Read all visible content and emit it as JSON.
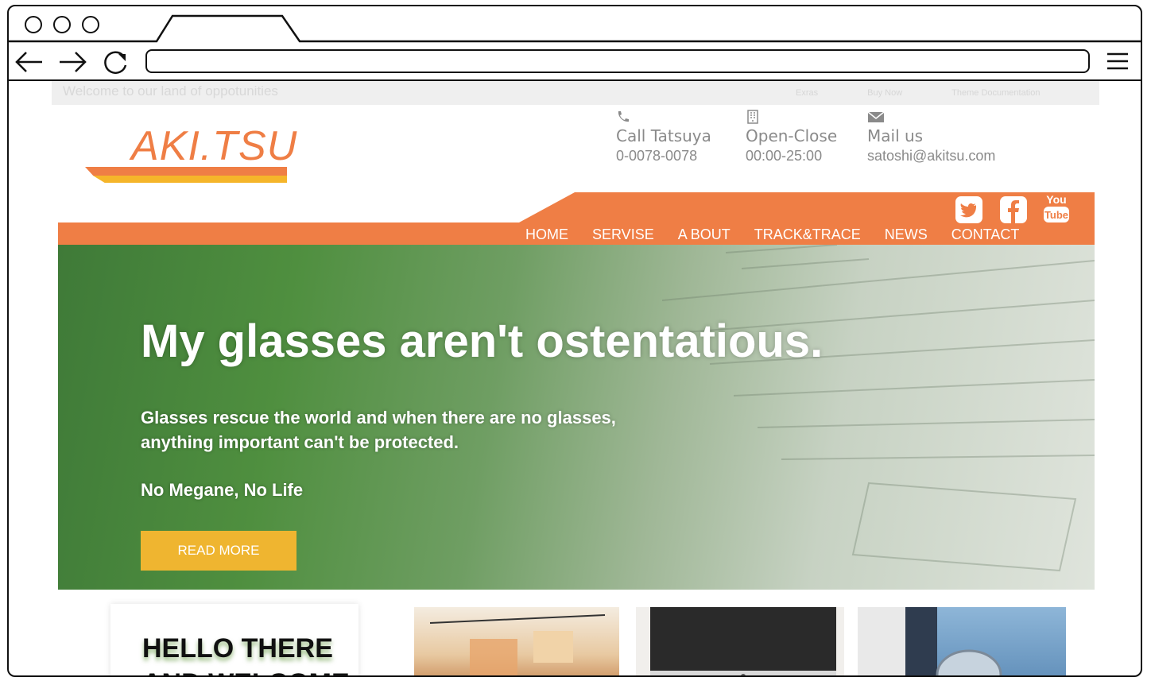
{
  "topbar": {
    "welcome": "Welcome to our land of oppotunities",
    "links": [
      "Exras",
      "Buy Now",
      "Theme Documentation"
    ]
  },
  "logo": {
    "text": "AKI.TSU"
  },
  "contacts": [
    {
      "icon": "phone-icon",
      "label": "Call Tatsuya",
      "value": "0-0078-0078"
    },
    {
      "icon": "building-icon",
      "label": "Open-Close",
      "value": "00:00-25:00"
    },
    {
      "icon": "envelope-icon",
      "label": "Mail us",
      "value": "satoshi@akitsu.com"
    }
  ],
  "nav": {
    "items": [
      "HOME",
      "SERVISE",
      "A BOUT",
      "TRACK&TRACE",
      "NEWS",
      "CONTACT"
    ]
  },
  "social": [
    "twitter-icon",
    "facebook-icon",
    "youtube-icon"
  ],
  "hero": {
    "headline": "My glasses aren't ostentatious.",
    "sub_line1": "Glasses rescue the world and when there are no glasses,",
    "sub_line2": "anything important can't be protected.",
    "tagline": "No Megane, No Life",
    "button": "READ MORE"
  },
  "welcome_card": {
    "title": "HELLO THERE\nAND WELCOME"
  },
  "colors": {
    "accent": "#ef7e45",
    "yellow": "#f5b52a",
    "button": "#efb530"
  }
}
